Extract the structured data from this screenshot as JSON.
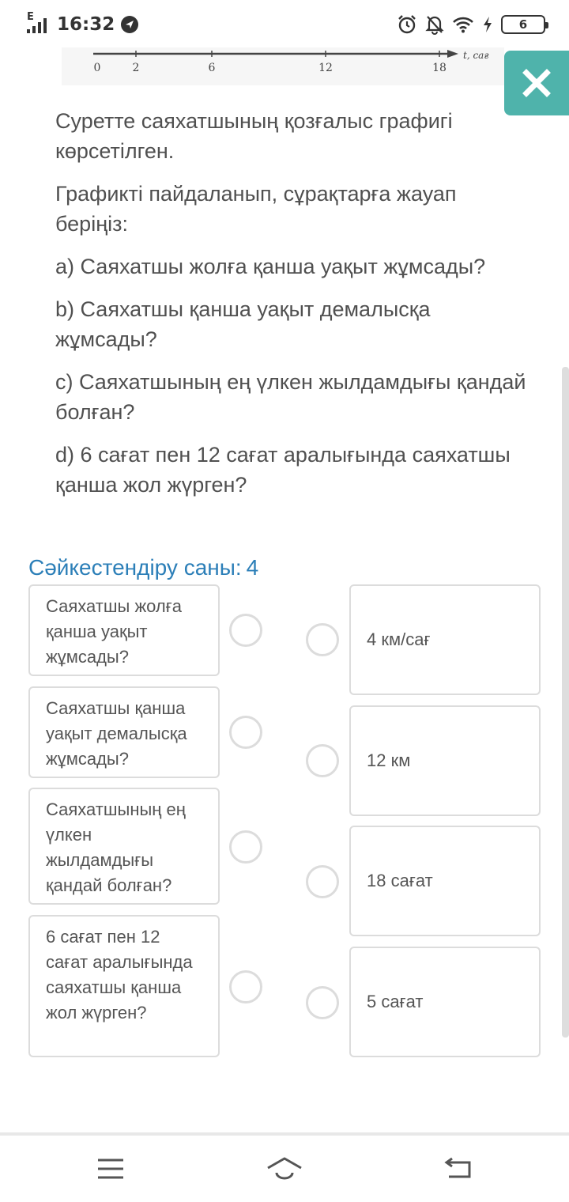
{
  "status_bar": {
    "network": "E",
    "time": "16:32",
    "battery": "6"
  },
  "graph": {
    "ticks": [
      "0",
      "2",
      "6",
      "12",
      "18"
    ],
    "axis_label": "t, сағ"
  },
  "question": {
    "intro": "Суретте саяхатшының қозғалыс графигі көрсетілген.",
    "instruction": "Графикті пайдаланып, сұрақтарға жауап беріңіз:",
    "items": [
      "a) Саяхатшы жолға қанша уақыт жұмсады?",
      "b) Саяхатшы қанша уақыт демалысқа жұмсады?",
      "c) Саяхатшының ең үлкен жылдамдығы қандай болған?",
      "d) 6 сағат пен 12 сағат аралығында саяхатшы қанша жол жүрген?"
    ]
  },
  "match": {
    "label": "Сәйкестендіру саны:",
    "count": "4",
    "left": [
      "Саяхатшы жолға қанша уақыт жұмсады?",
      "Саяхатшы қанша уақыт демалысқа жұмсады?",
      "Саяхатшының ең үлкен жылдамдығы қандай болған?",
      "6 сағат пен 12 сағат аралығында саяхатшы қанша жол жүрген?"
    ],
    "right": [
      "4 км/сағ",
      "12 км",
      "18 сағат",
      "5 сағат"
    ]
  },
  "icons": {
    "close": "close-icon",
    "menu": "menu-icon",
    "home": "home-icon",
    "back": "back-icon"
  },
  "colors": {
    "accent": "#4fb3ab",
    "link": "#2c7fb8"
  }
}
